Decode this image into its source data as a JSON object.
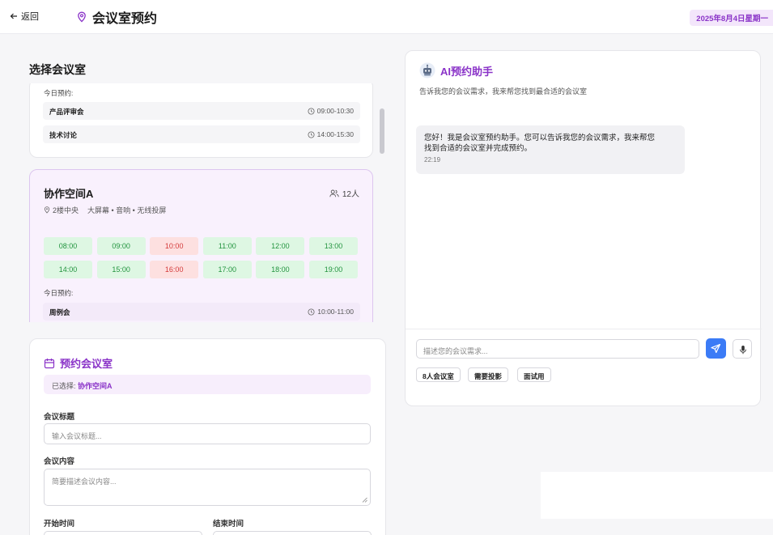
{
  "header": {
    "back_label": "返回",
    "title": "会议室预约",
    "date": "2025年8月4日星期一"
  },
  "rooms_section": {
    "title": "选择会议室",
    "room_prev": {
      "today_label": "今日预约:",
      "bookings": [
        {
          "name": "产品评审会",
          "time": "09:00-10:30"
        },
        {
          "name": "技术讨论",
          "time": "14:00-15:30"
        }
      ]
    },
    "room_a": {
      "name": "协作空间A",
      "capacity": "12人",
      "location": "2楼中央",
      "features": "大屏幕 • 音响 • 无线投屏",
      "slots": [
        {
          "time": "08:00",
          "status": "free"
        },
        {
          "time": "09:00",
          "status": "free"
        },
        {
          "time": "10:00",
          "status": "busy"
        },
        {
          "time": "11:00",
          "status": "free"
        },
        {
          "time": "12:00",
          "status": "free"
        },
        {
          "time": "13:00",
          "status": "free"
        },
        {
          "time": "14:00",
          "status": "free"
        },
        {
          "time": "15:00",
          "status": "free"
        },
        {
          "time": "16:00",
          "status": "busy"
        },
        {
          "time": "17:00",
          "status": "free"
        },
        {
          "time": "18:00",
          "status": "free"
        },
        {
          "time": "19:00",
          "status": "free"
        }
      ],
      "today_label": "今日预约:",
      "bookings": [
        {
          "name": "周例会",
          "time": "10:00-11:00"
        }
      ]
    }
  },
  "booking_form": {
    "title": "预约会议室",
    "selected_prefix": "已选择:",
    "selected_room": "协作空间A",
    "title_label": "会议标题",
    "title_placeholder": "输入会议标题...",
    "content_label": "会议内容",
    "content_placeholder": "简要描述会议内容...",
    "start_label": "开始时间",
    "end_label": "结束时间"
  },
  "assistant": {
    "title": "AI预约助手",
    "subtitle": "告诉我您的会议需求，我来帮您找到最合适的会议室",
    "message_line1": "您好！我是会议室预约助手。您可以告诉我您的会议需求，我来帮您",
    "message_line2": "找到合适的会议室并完成预约。",
    "message_time": "22:19",
    "input_placeholder": "描述您的会议需求...",
    "quick_replies": [
      "8人会议室",
      "需要投影",
      "面试用"
    ]
  },
  "colors": {
    "accent": "#8a33c8",
    "send": "#3b7bf6",
    "slot_free": "#23943f",
    "slot_busy": "#d43a3a"
  }
}
